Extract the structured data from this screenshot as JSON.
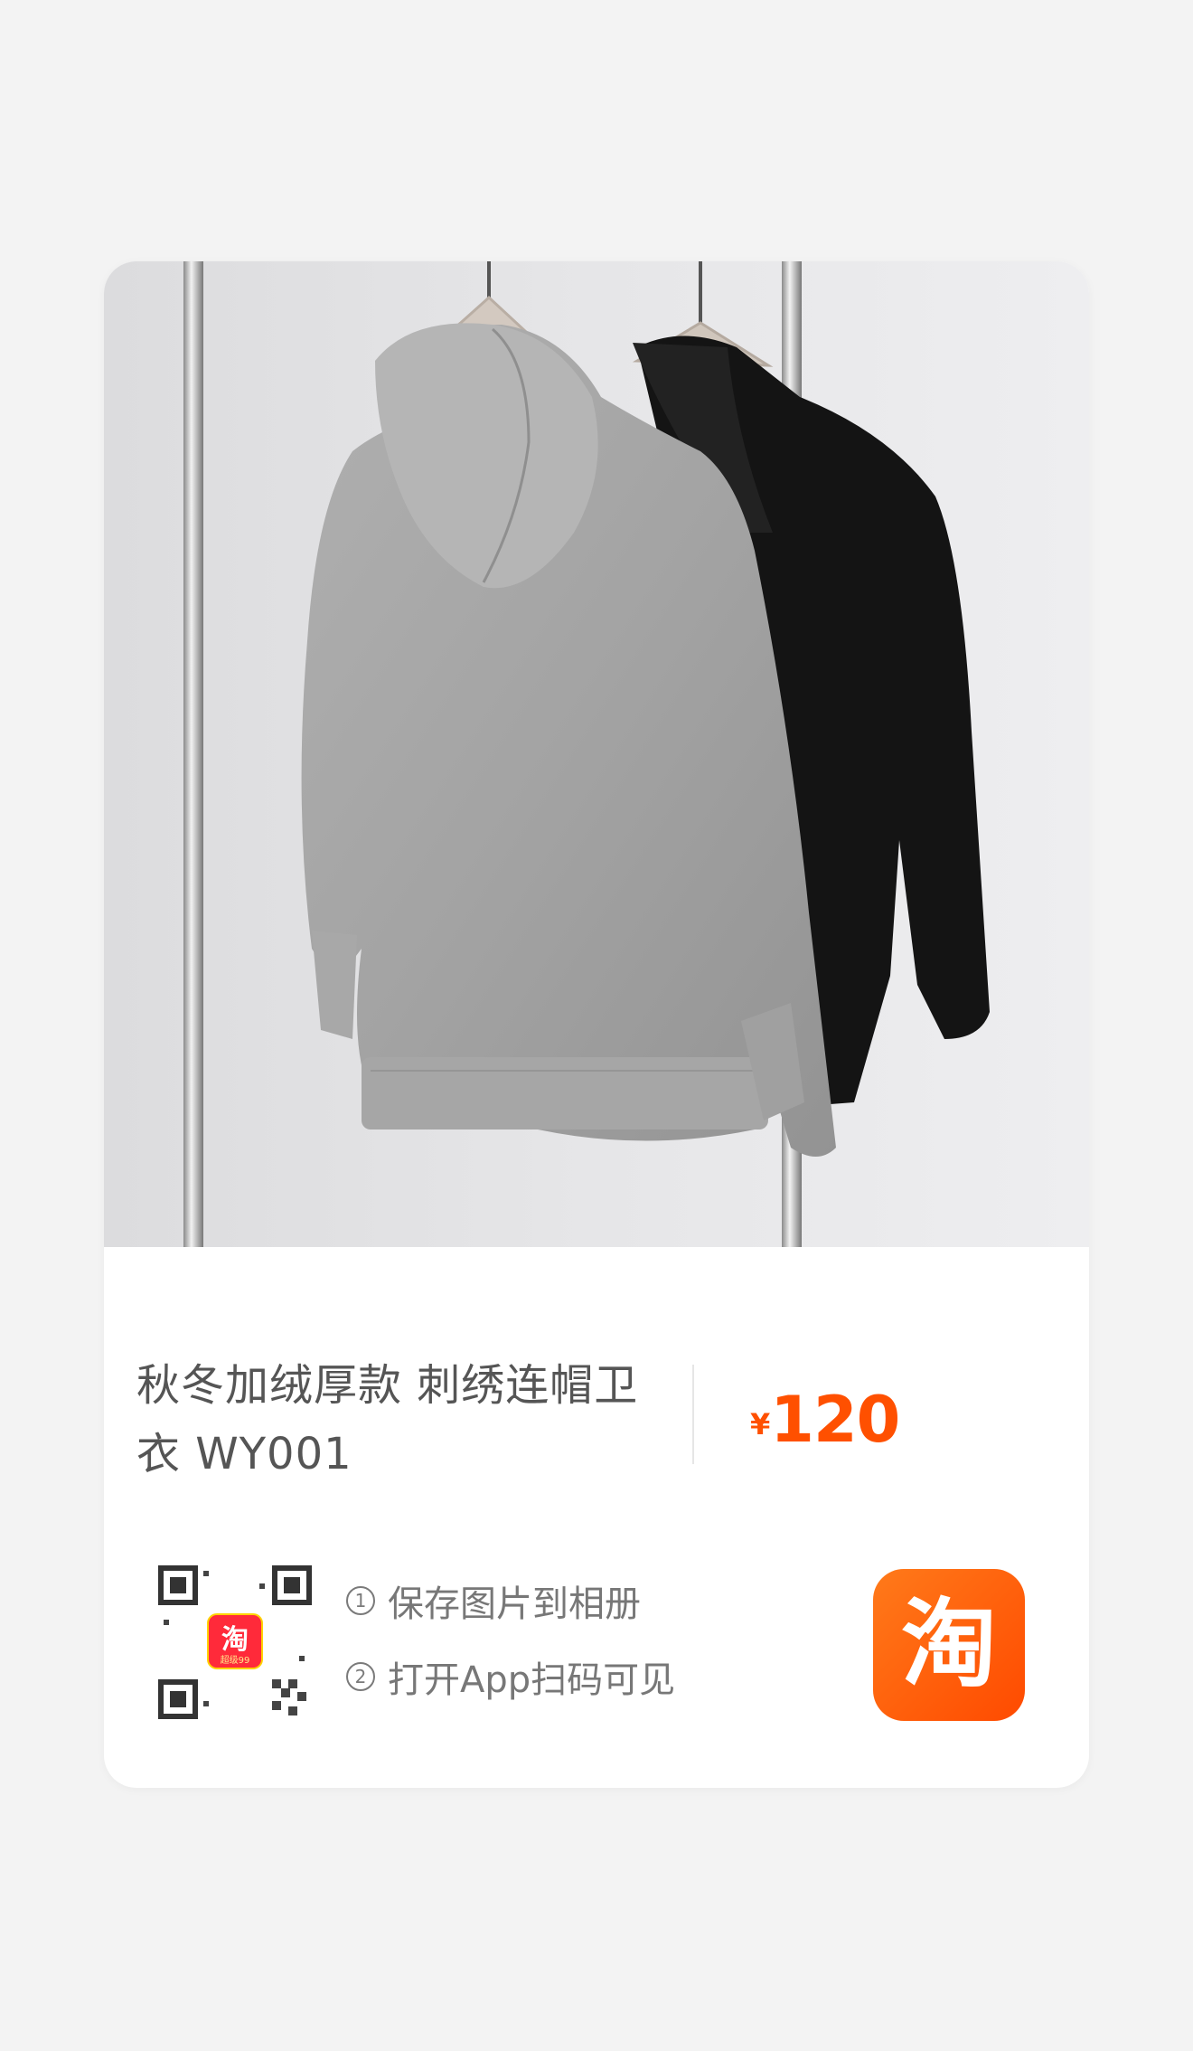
{
  "product": {
    "title": "秋冬加绒厚款 刺绣连帽卫衣 WY001",
    "currency_symbol": "¥",
    "price": "120"
  },
  "share": {
    "step1_num": "1",
    "step1_text": "保存图片到相册",
    "step2_num": "2",
    "step2_text": "打开App扫码可见",
    "qr_badge_text": "淘",
    "qr_badge_sub": "超级99",
    "app_icon_text": "淘"
  },
  "colors": {
    "accent": "#ff5000",
    "icon_gradient_start": "#ff7a1a",
    "icon_gradient_end": "#ff4a00"
  }
}
